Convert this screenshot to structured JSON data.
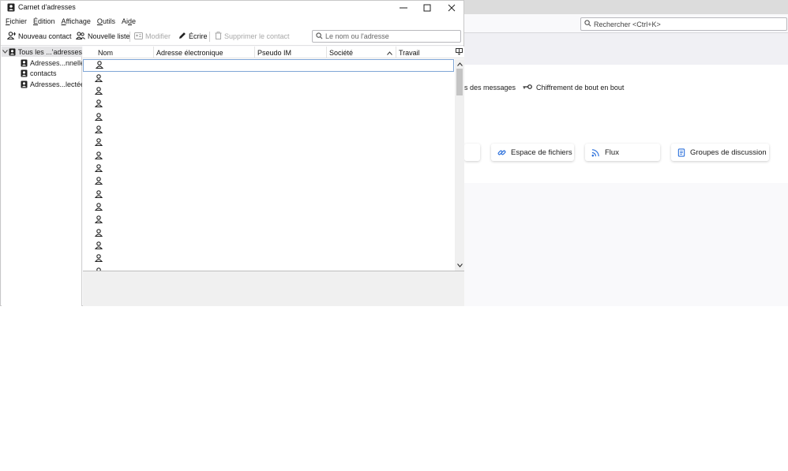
{
  "background_window": {
    "search_placeholder": "Rechercher <Ctrl+K>",
    "links": [
      {
        "label": "s des messages"
      },
      {
        "label": "Chiffrement de bout en bout",
        "icon": "key-icon"
      }
    ],
    "cards": [
      {
        "label": "Espace de fichiers",
        "icon": "link-icon"
      },
      {
        "label": "Flux",
        "icon": "rss-icon"
      },
      {
        "label": "Groupes de discussion",
        "icon": "newsgroup-icon"
      }
    ]
  },
  "window": {
    "title": "Carnet d'adresses",
    "controls": [
      "minimize",
      "maximize",
      "close"
    ]
  },
  "menubar": [
    {
      "label": "Fichier",
      "key": "F"
    },
    {
      "label": "Édition",
      "key": "É"
    },
    {
      "label": "Affichage",
      "key": "A"
    },
    {
      "label": "Outils",
      "key": "O"
    },
    {
      "label": "Aide",
      "key": "d"
    }
  ],
  "toolbar": {
    "new_contact": "Nouveau contact",
    "new_list": "Nouvelle liste",
    "edit": "Modifier",
    "write": "Écrire",
    "delete": "Supprimer le contact",
    "search_placeholder": "Le nom ou l'adresse"
  },
  "directories": [
    {
      "label": "Tous les ...'adresses",
      "selected": true,
      "expanded": true
    },
    {
      "label": "Adresses...nnelles"
    },
    {
      "label": "contacts"
    },
    {
      "label": "Adresses...lectées"
    }
  ],
  "columns": [
    "Nom",
    "Adresse électronique",
    "Pseudo IM",
    "Société",
    "Travail"
  ],
  "sorted_column": "Société",
  "contact_rows_visible": 17,
  "colors": {
    "accent": "#2a6fdb",
    "selection_border": "#7fa6d6"
  }
}
